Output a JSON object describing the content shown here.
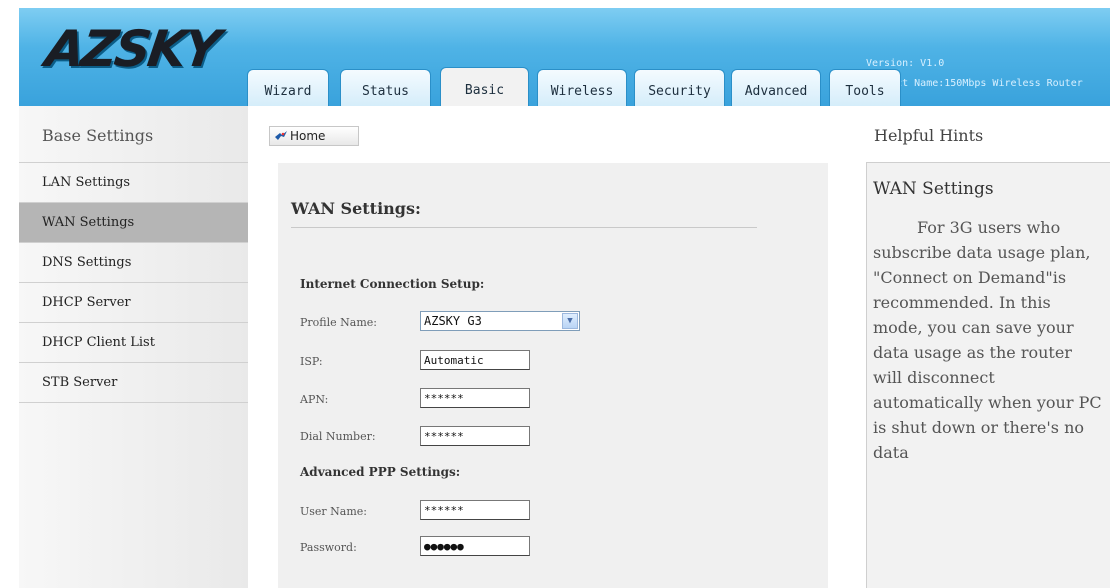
{
  "header": {
    "logo": "AZSKY",
    "version": "Version: V1.0",
    "product": "Product Name:150Mbps Wireless Router",
    "tabs": [
      "Wizard",
      "Status",
      "Basic",
      "Wireless",
      "Security",
      "Advanced",
      "Tools"
    ],
    "active_tab": "Basic"
  },
  "sidebar": {
    "title": "Base Settings",
    "items": [
      "LAN Settings",
      "WAN Settings",
      "DNS Settings",
      "DHCP Server",
      "DHCP Client List",
      "STB Server"
    ],
    "active_item": "WAN Settings"
  },
  "main": {
    "home_label": "Home",
    "title": "WAN Settings:",
    "internet_section": "Internet Connection Setup:",
    "profile_label": "Profile Name:",
    "profile_value": "AZSKY G3",
    "isp_label": "ISP:",
    "isp_value": "Automatic",
    "apn_label": "APN:",
    "apn_value": "******",
    "dial_label": "Dial Number:",
    "dial_value": "******",
    "ppp_section": "Advanced PPP Settings:",
    "user_label": "User Name:",
    "user_value": "******",
    "password_label": "Password:",
    "password_value": "●●●●●●"
  },
  "hints": {
    "title": "Helpful Hints",
    "heading": "WAN Settings",
    "text": "For 3G users who subscribe data usage plan, \"Connect on Demand\"is recommended. In this mode, you can save your data usage as the router will disconnect automatically when your PC is shut down or there's no data"
  },
  "colors": {
    "header_top": "#7ecdf2",
    "header_bottom": "#39a2dc",
    "sidebar_active": "#b5b5b5",
    "panel": "#f0f0f0"
  }
}
